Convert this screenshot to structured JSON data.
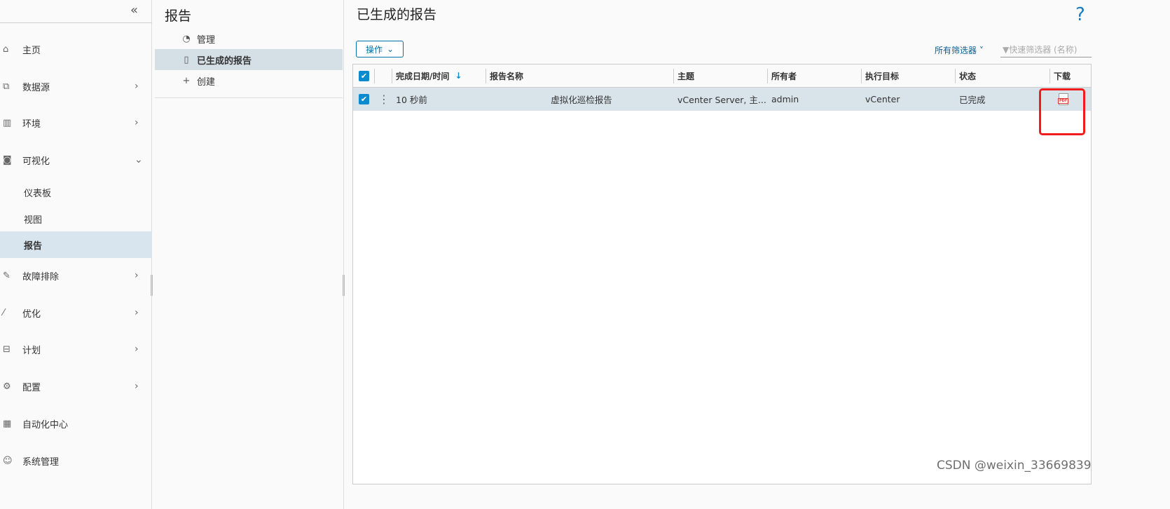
{
  "sidebar": {
    "collapse_icon": "«",
    "items": [
      {
        "label": "主页",
        "icon": "home-icon"
      },
      {
        "label": "数据源",
        "icon": "puzzle-icon"
      },
      {
        "label": "环境",
        "icon": "library-icon"
      },
      {
        "label": "可视化",
        "icon": "chart-icon"
      },
      {
        "label": "仪表板"
      },
      {
        "label": "视图"
      },
      {
        "label": "报告"
      },
      {
        "label": "故障排除",
        "icon": "wrench-icon"
      },
      {
        "label": "优化",
        "icon": "wand-icon"
      },
      {
        "label": "计划",
        "icon": "briefcase-icon"
      },
      {
        "label": "配置",
        "icon": "gear-icon"
      },
      {
        "label": "自动化中心",
        "icon": "calendar-icon"
      },
      {
        "label": "系统管理",
        "icon": "user-gear-icon"
      }
    ]
  },
  "mid": {
    "title": "报告",
    "items": [
      {
        "label": "管理"
      },
      {
        "label": "已生成的报告"
      },
      {
        "label": "创建"
      }
    ]
  },
  "main": {
    "title": "已生成的报告",
    "help": "?",
    "actions_label": "操作",
    "all_filters": "所有筛选器",
    "quick_filter_placeholder": "快速筛选器 (名称)",
    "columns": [
      "完成日期/时间",
      "报告名称",
      "主题",
      "所有者",
      "执行目标",
      "状态",
      "下载"
    ],
    "rows": [
      {
        "date": "10 秒前",
        "name": "虚拟化巡检报告",
        "subject": "vCenter Server, 主...",
        "owner": "admin",
        "target": "vCenter",
        "status": "已完成",
        "download": "PDF"
      }
    ]
  },
  "watermark": "CSDN @weixin_33669839",
  "colors": {
    "accent": "#0072a3",
    "selected": "#d8e4ee",
    "highlight": "#f01c1c"
  }
}
